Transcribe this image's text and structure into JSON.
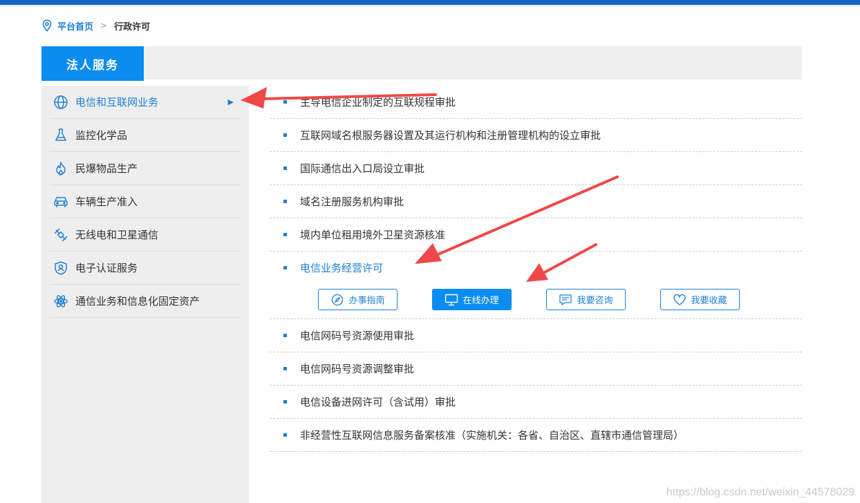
{
  "breadcrumb": {
    "home": "平台首页",
    "current": "行政许可"
  },
  "header": {
    "tab_label": "法人服务"
  },
  "sidebar": {
    "items": [
      {
        "label": "电信和互联网业务",
        "icon": "globe-icon",
        "active": true
      },
      {
        "label": "监控化学品",
        "icon": "flask-icon"
      },
      {
        "label": "民爆物品生产",
        "icon": "flame-icon"
      },
      {
        "label": "车辆生产准入",
        "icon": "car-icon"
      },
      {
        "label": "无线电和卫星通信",
        "icon": "satellite-icon"
      },
      {
        "label": "电子认证服务",
        "icon": "user-shield-icon"
      },
      {
        "label": "通信业务和信息化固定资产",
        "icon": "atom-icon"
      }
    ],
    "active_arrow": "▶"
  },
  "list": {
    "items": [
      {
        "label": "主导电信企业制定的互联规程审批"
      },
      {
        "label": "互联网域名根服务器设置及其运行机构和注册管理机构的设立审批"
      },
      {
        "label": "国际通信出入口局设立审批"
      },
      {
        "label": "域名注册服务机构审批"
      },
      {
        "label": "境内单位租用境外卫星资源核准"
      },
      {
        "label": "电信业务经营许可",
        "active": true
      },
      {
        "label": "电信网码号资源使用审批"
      },
      {
        "label": "电信网码号资源调整审批"
      },
      {
        "label": "电信设备进网许可（含试用）审批"
      },
      {
        "label": "非经营性互联网信息服务备案核准（实施机关：各省、自治区、直辖市通信管理局）"
      }
    ],
    "actions": [
      {
        "label": "办事指南",
        "icon": "compass-icon"
      },
      {
        "label": "在线办理",
        "icon": "monitor-icon",
        "primary": true
      },
      {
        "label": "我要咨询",
        "icon": "message-icon"
      },
      {
        "label": "我要收藏",
        "icon": "heart-icon"
      }
    ]
  },
  "colors": {
    "accent": "#0a8cf0",
    "link": "#1e7fd6",
    "annotation_arrow": "#f04848"
  },
  "watermark": "https://blog.csdn.net/weixin_44578029"
}
